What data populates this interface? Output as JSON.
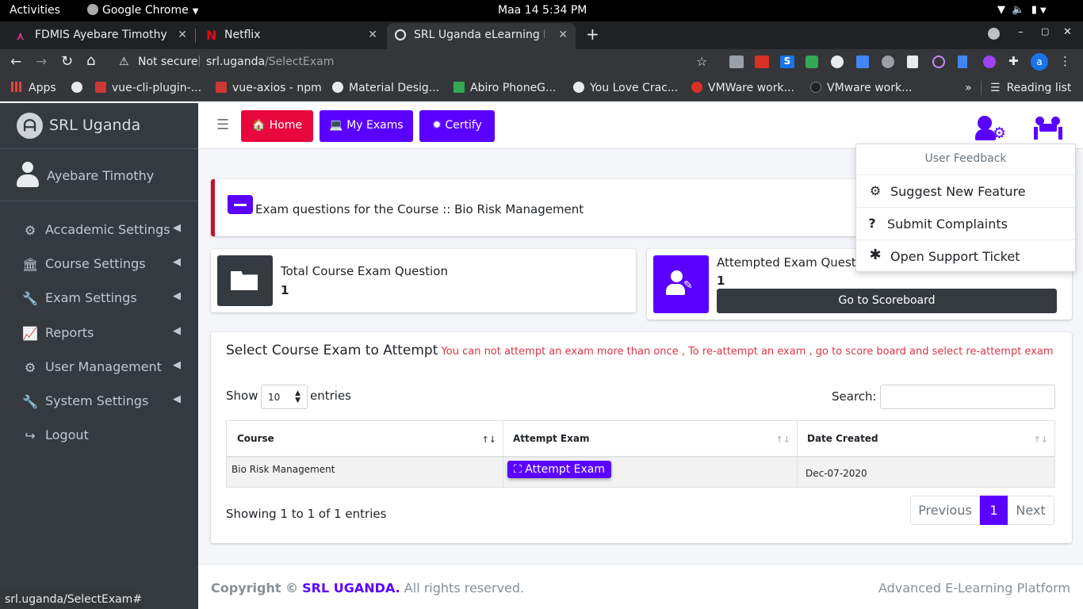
{
  "os_bar": {
    "activities": "Activities",
    "app": "Google Chrome",
    "datetime": "Maa 14  5:34 PM"
  },
  "tabs": [
    {
      "title": "FDMIS Ayebare Timothy",
      "icon": "fdmis-icon",
      "color": "#b5179e"
    },
    {
      "title": "Netflix",
      "icon": "netflix-icon",
      "color": "#e50914"
    },
    {
      "title": "SRL Uganda eLearning Ex",
      "icon": "globe-icon",
      "active": true
    }
  ],
  "address": {
    "security": "Not secure",
    "host": "srl.uganda",
    "path": "/SelectExam"
  },
  "bookmarks": {
    "apps": "Apps",
    "items": [
      "vue-cli-plugin-...",
      "vue-axios - npm",
      "Material Desig...",
      "Abiro PhoneG...",
      "You Love Crac...",
      "VMWare work...",
      "VMware work..."
    ],
    "overflow": "»",
    "reading_list": "Reading list"
  },
  "sidebar": {
    "brand": "SRL Uganda",
    "user": "Ayebare Timothy",
    "items": [
      {
        "label": "Accademic Settings",
        "icon": "gear-icon"
      },
      {
        "label": "Course Settings",
        "icon": "institution-icon"
      },
      {
        "label": "Exam Settings",
        "icon": "wrench-icon"
      },
      {
        "label": "Reports",
        "icon": "chart-icon"
      },
      {
        "label": "User Management",
        "icon": "gears-icon"
      },
      {
        "label": "System Settings",
        "icon": "wrench-icon"
      },
      {
        "label": "Logout",
        "icon": "logout-icon"
      }
    ]
  },
  "header": {
    "home": "Home",
    "my_exams": "My Exams",
    "certify": "Certify"
  },
  "colors": {
    "primary": "#5a00ff",
    "danger": "#e8083e",
    "dark": "#343a40"
  },
  "page": {
    "callout": "Exam questions for the Course :: Bio Risk Management",
    "total_label": "Total Course Exam Question",
    "total_value": "1",
    "attempted_label": "Attempted Exam Questi",
    "attempted_value": "1",
    "scoreboard_button": "Go to Scoreboard",
    "card_title": "Select Course Exam to Attempt",
    "card_warning": "You can not attempt an exam more than once , To re-attempt an exam , go to score board and select re-attempt exam",
    "show": "Show",
    "entries_value": "10",
    "entries": "entries",
    "search_label": "Search:",
    "columns": [
      "Course",
      "Attempt Exam",
      "Date Created"
    ],
    "rows": [
      {
        "course": "Bio Risk Management",
        "action": "Attempt Exam",
        "date": "Dec-07-2020"
      }
    ],
    "info": "Showing 1 to 1 of 1 entries",
    "prev": "Previous",
    "page_num": "1",
    "next": "Next"
  },
  "dropdown": {
    "header": "User Feedback",
    "items": [
      "Suggest New Feature",
      "Submit Complaints",
      "Open Support Ticket"
    ]
  },
  "footer": {
    "copyright": "Copyright ©",
    "brand": "SRL UGANDA.",
    "rights": "All rights reserved.",
    "right_text": "Advanced E-Learning Platform"
  },
  "status_url": "srl.uganda/SelectExam#"
}
